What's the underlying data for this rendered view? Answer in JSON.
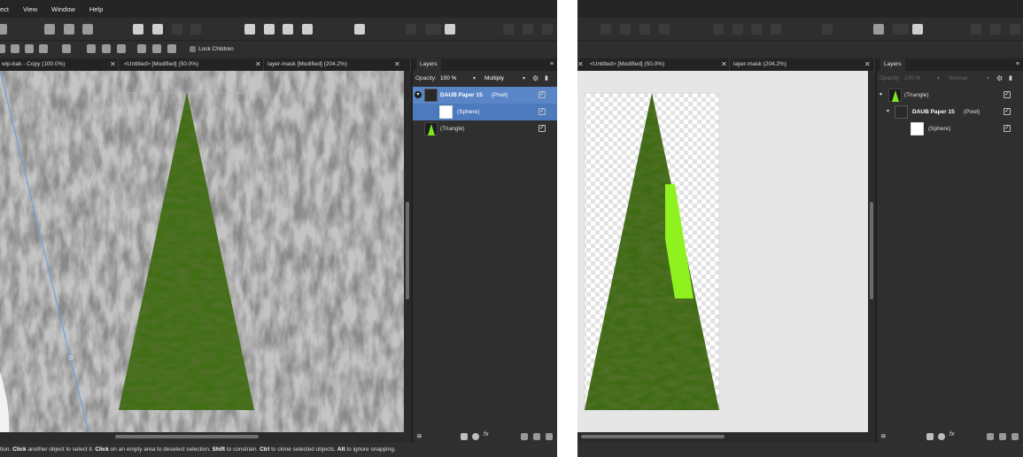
{
  "left": {
    "menu": [
      "ect",
      "View",
      "Window",
      "Help"
    ],
    "lock_children_label": "Lock Children",
    "tabs": [
      {
        "label": "wip-bak - Copy (100.0%)"
      },
      {
        "label": "<Untitled> [Modified] (50.0%)"
      },
      {
        "label": "layer-mask [Modified] (204.2%)"
      }
    ],
    "layers_tab": "Layers",
    "opacity_label": "Opacity:",
    "opacity_value": "100 %",
    "blend_mode": "Multiply",
    "layers": [
      {
        "name": "DAUB Paper 15",
        "type": "(Pixel)"
      },
      {
        "name": "(Sphere)"
      },
      {
        "name": "(Triangle)"
      }
    ],
    "status": {
      "p1": "tion. ",
      "k1": "Click",
      "p2": " another object to select it. ",
      "k2": "Click",
      "p3": " on an empty area to deselect selection. ",
      "k3": "Shift",
      "p4": " to constrain. ",
      "k4": "Ctrl",
      "p5": " to clone selected objects. ",
      "k5": "Alt",
      "p6": " to ignore snapping."
    }
  },
  "right": {
    "tabs": [
      {
        "label": "<Untitled> [Modified] (50.0%)"
      },
      {
        "label": "layer-mask (204.2%)"
      }
    ],
    "layers_tab": "Layers",
    "opacity_label": "Opacity:",
    "opacity_value": "100 %",
    "blend_mode": "Normal",
    "layers": [
      {
        "name": "(Triangle)"
      },
      {
        "name": "DAUB Paper 15",
        "type": "(Pixel)"
      },
      {
        "name": "(Sphere)"
      }
    ]
  },
  "colors": {
    "ui_dark": "#2b2b2b",
    "selection_blue": "#5a86c7",
    "triangle_green": "#3d6a12",
    "sphere_green": "#8ff21f",
    "texture_gray": "#8c8c8c",
    "selection_guide": "#6aa0e0"
  },
  "icons": [
    "tab-close-icon",
    "gear-icon",
    "lock-icon",
    "checkbox-icon",
    "expand-caret-icon",
    "fx-icon",
    "mask-icon",
    "adjustment-icon",
    "new-layer-icon",
    "delete-icon",
    "panel-menu-icon"
  ]
}
